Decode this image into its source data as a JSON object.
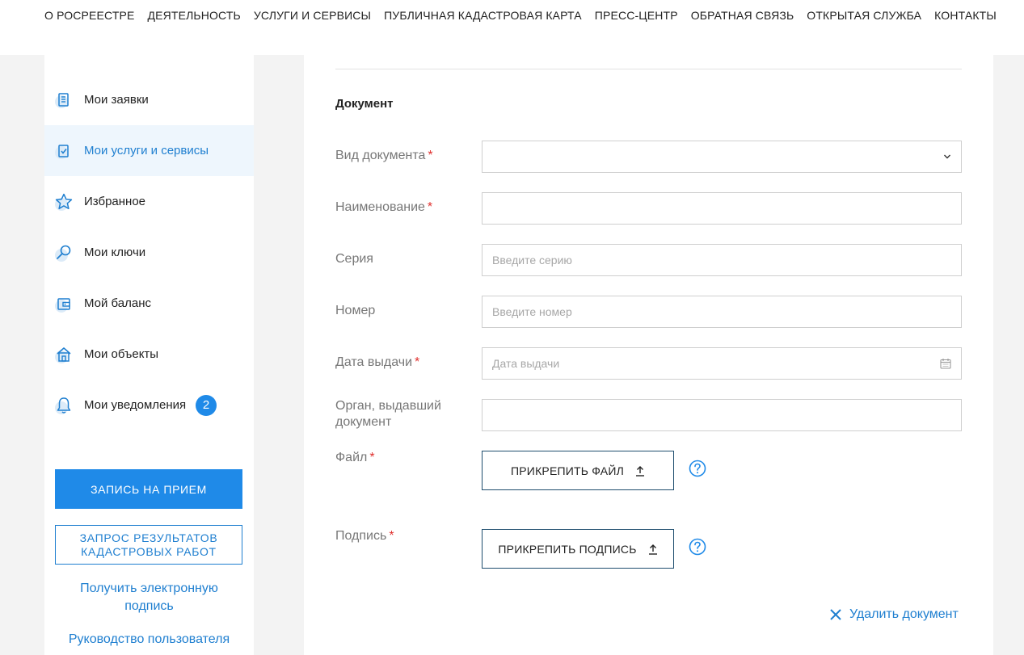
{
  "topnav": {
    "items": [
      "О РОСРЕЕСТРЕ",
      "ДЕЯТЕЛЬНОСТЬ",
      "УСЛУГИ И СЕРВИСЫ",
      "ПУБЛИЧНАЯ КАДАСТРОВАЯ КАРТА",
      "ПРЕСС-ЦЕНТР",
      "ОБРАТНАЯ СВЯЗЬ",
      "ОТКРЫТАЯ СЛУЖБА",
      "КОНТАКТЫ"
    ]
  },
  "sidebar": {
    "items": [
      {
        "label": "Мои заявки",
        "icon": "document-list-icon"
      },
      {
        "label": "Мои услуги и сервисы",
        "icon": "checklist-icon",
        "active": true
      },
      {
        "label": "Избранное",
        "icon": "star-icon"
      },
      {
        "label": "Мои ключи",
        "icon": "magnifier-icon"
      },
      {
        "label": "Мой баланс",
        "icon": "wallet-icon"
      },
      {
        "label": "Мои объекты",
        "icon": "house-icon"
      },
      {
        "label": "Мои уведомления",
        "icon": "bell-icon",
        "badge": "2"
      }
    ],
    "appointment_button": "ЗАПИСЬ НА ПРИЕМ",
    "cadastral_button_line1": "ЗАПРОС РЕЗУЛЬТАТОВ",
    "cadastral_button_line2": "КАДАСТРОВЫХ РАБОТ",
    "signature_link_line1": "Получить электронную",
    "signature_link_line2": "подпись",
    "manual_link": "Руководство пользователя"
  },
  "form": {
    "section_title": "Документ",
    "doc_type_label": "Вид документа",
    "name_label": "Наименование",
    "series_label": "Серия",
    "series_placeholder": "Введите серию",
    "number_label": "Номер",
    "number_placeholder": "Введите номер",
    "issue_date_label": "Дата выдачи",
    "issue_date_placeholder": "Дата выдачи",
    "issuer_label_line1": "Орган, выдавший",
    "issuer_label_line2": "документ",
    "file_label": "Файл",
    "attach_file_button": "ПРИКРЕПИТЬ ФАЙЛ",
    "signature_label": "Подпись",
    "attach_signature_button": "ПРИКРЕПИТЬ ПОДПИСЬ",
    "required_mark": "*",
    "delete_document": "Удалить документ"
  },
  "colors": {
    "accent": "#1f8ae8",
    "link": "#1f7fd0",
    "required": "#e0312f",
    "active_bg": "#eef6fd"
  }
}
